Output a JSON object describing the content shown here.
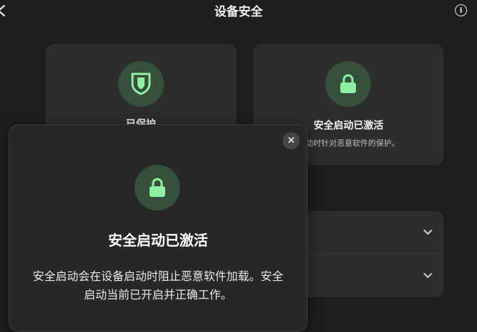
{
  "header": {
    "back_icon": "chevron-left-icon",
    "title": "设备安全",
    "info_icon": "info-icon",
    "info_glyph": "i"
  },
  "cards": [
    {
      "icon": "shield-icon",
      "title": "已保护",
      "description": ""
    },
    {
      "icon": "lock-icon",
      "title": "安全启动已激活",
      "description": "启动时针对恶意软件的保护。"
    }
  ],
  "list": {
    "rows": [
      {
        "icon": "chevron-down-icon"
      },
      {
        "icon": "chevron-down-icon"
      }
    ]
  },
  "dialog": {
    "close_icon": "close-icon",
    "close_glyph": "✕",
    "icon": "lock-icon",
    "title": "安全启动已激活",
    "body": "安全启动会在设备启动时阻止恶意软件加载。安全启动当前已开启并正确工作。"
  },
  "colors": {
    "background": "#1e1e1e",
    "card": "#2d2d2d",
    "icon_circle": "#36503c",
    "accent_green": "#8ff0a4",
    "dialog": "#272727"
  }
}
